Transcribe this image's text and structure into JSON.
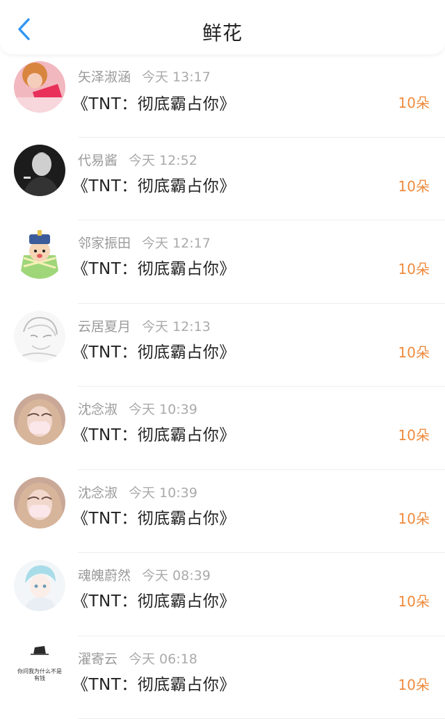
{
  "header": {
    "title": "鲜花"
  },
  "colors": {
    "accent_blue": "#2f95f3",
    "count_orange": "#ef8a3c"
  },
  "items": [
    {
      "user": "矢泽淑涵",
      "time": "今天 13:17",
      "work": "《TNT：彻底霸占你》",
      "count": "10朵",
      "avatar": "pink-photo"
    },
    {
      "user": "代易酱",
      "time": "今天 12:52",
      "work": "《TNT：彻底霸占你》",
      "count": "10朵",
      "avatar": "bw-photo"
    },
    {
      "user": "邻家振田",
      "time": "今天 12:17",
      "work": "《TNT：彻底霸占你》",
      "count": "10朵",
      "avatar": "cartoon-green"
    },
    {
      "user": "云居夏月",
      "time": "今天 12:13",
      "work": "《TNT：彻底霸占你》",
      "count": "10朵",
      "avatar": "sketch"
    },
    {
      "user": "沈念淑",
      "time": "今天 10:39",
      "work": "《TNT：彻底霸占你》",
      "count": "10朵",
      "avatar": "mask-photo"
    },
    {
      "user": "沈念淑",
      "time": "今天 10:39",
      "work": "《TNT：彻底霸占你》",
      "count": "10朵",
      "avatar": "mask-photo"
    },
    {
      "user": "魂魄蔚然",
      "time": "今天 08:39",
      "work": "《TNT：彻底霸占你》",
      "count": "10朵",
      "avatar": "anime-boy"
    },
    {
      "user": "濯寄云",
      "time": "今天 06:18",
      "work": "《TNT：彻底霸占你》",
      "count": "10朵",
      "avatar": "text-meme",
      "avatar_text": "你问我为什么不是有钱"
    }
  ]
}
